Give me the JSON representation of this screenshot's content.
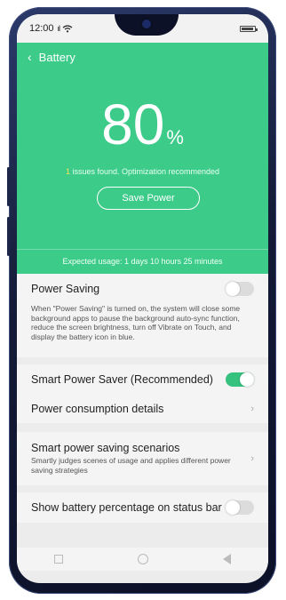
{
  "status": {
    "time": "12:00",
    "signal": "il"
  },
  "header": {
    "back_glyph": "‹",
    "title": "Battery"
  },
  "battery": {
    "percent": "80",
    "unit": "%",
    "issues_count": "1",
    "issues_text": " issues found. Optimization recommended",
    "save_button": "Save Power",
    "expected_usage": "Expected usage: 1 days 10 hours 25 minutes"
  },
  "power_saving": {
    "label": "Power Saving",
    "enabled": false,
    "description": "When \"Power Saving\" is turned on, the system will close some background apps to pause the background auto-sync function, reduce the screen brightness, turn off Vibrate on Touch, and display the battery icon in blue."
  },
  "smart_saver": {
    "label": "Smart Power Saver (Recommended)",
    "enabled": true
  },
  "consumption": {
    "label": "Power consumption details",
    "chevron": "›"
  },
  "scenarios": {
    "label": "Smart power saving scenarios",
    "description": "Smartly judges scenes of usage and applies different power saving strategies",
    "chevron": "›"
  },
  "show_percentage": {
    "label": "Show battery percentage on status bar",
    "enabled": false
  },
  "colors": {
    "accent": "#3dcb8a",
    "toggle_on": "#35c27f",
    "issue_count": "#f9e35a"
  }
}
